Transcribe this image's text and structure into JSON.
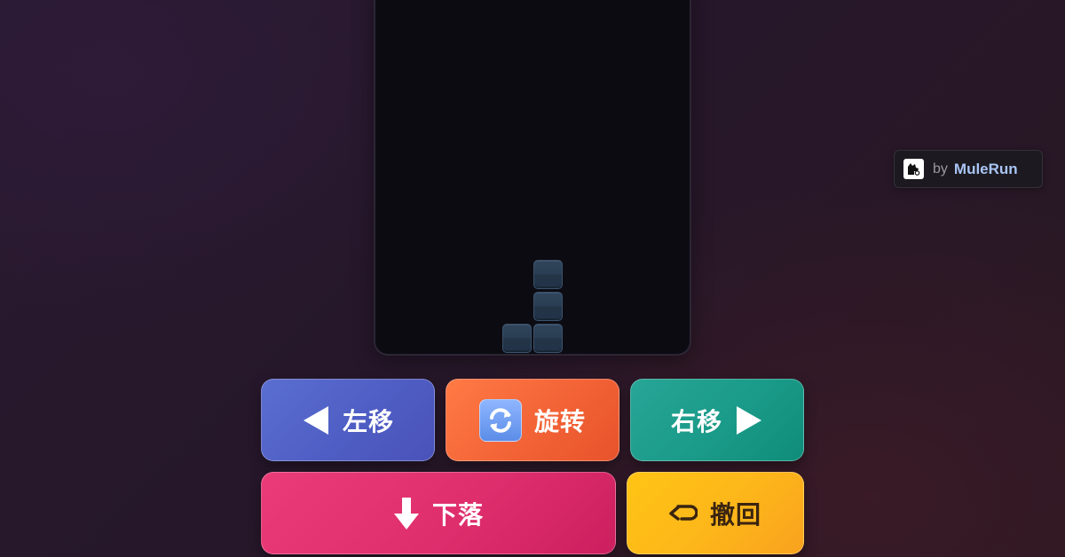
{
  "board": {
    "active_piece": {
      "shape": "J",
      "color": "#2a3d53"
    }
  },
  "badge": {
    "by_text": "by",
    "brand": "MuleRun",
    "brand_color": "#a9c4f5"
  },
  "controls": {
    "move_left": {
      "label": "左移",
      "icon": "triangle-left-icon",
      "color": "#5063c6"
    },
    "rotate": {
      "label": "旋转",
      "icon": "rotate-arrows-icon",
      "color": "#f26336"
    },
    "move_right": {
      "label": "右移",
      "icon": "triangle-right-icon",
      "color": "#1a9a88"
    },
    "drop": {
      "label": "下落",
      "icon": "arrow-down-icon",
      "color": "#df2e6c"
    },
    "undo": {
      "label": "撤回",
      "icon": "undo-arrow-icon",
      "color": "#fdb61a"
    }
  }
}
